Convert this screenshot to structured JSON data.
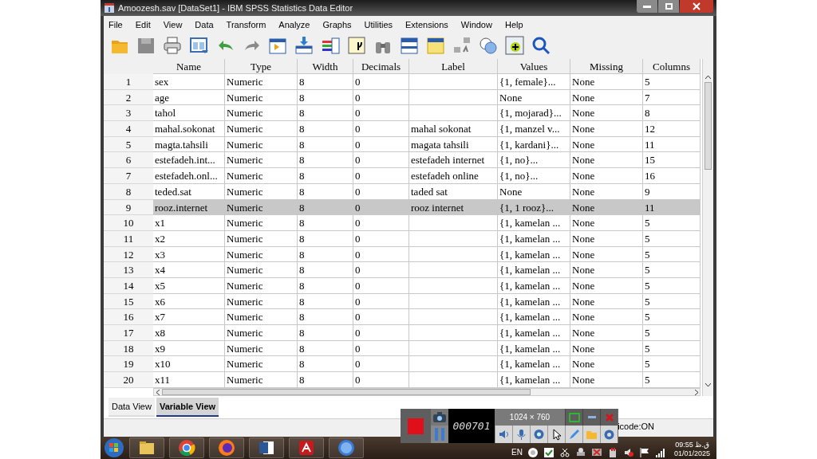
{
  "window": {
    "title": "Amoozesh.sav [DataSet1] - IBM SPSS Statistics Data Editor"
  },
  "menu": [
    "File",
    "Edit",
    "View",
    "Data",
    "Transform",
    "Analyze",
    "Graphs",
    "Utilities",
    "Extensions",
    "Window",
    "Help"
  ],
  "table": {
    "columns": [
      "Name",
      "Type",
      "Width",
      "Decimals",
      "Label",
      "Values",
      "Missing",
      "Columns"
    ],
    "rows": [
      {
        "number": "1",
        "cells": [
          "sex",
          "Numeric",
          "8",
          "0",
          "",
          "{1, female}...",
          "None",
          "5"
        ],
        "selected": false
      },
      {
        "number": "2",
        "cells": [
          "age",
          "Numeric",
          "8",
          "0",
          "",
          "None",
          "None",
          "7"
        ],
        "selected": false
      },
      {
        "number": "3",
        "cells": [
          "tahol",
          "Numeric",
          "8",
          "0",
          "",
          "{1, mojarad}...",
          "None",
          "8"
        ],
        "selected": false
      },
      {
        "number": "4",
        "cells": [
          "mahal.sokonat",
          "Numeric",
          "8",
          "0",
          "mahal sokonat",
          "{1, manzel v...",
          "None",
          "12"
        ],
        "selected": false
      },
      {
        "number": "5",
        "cells": [
          "magta.tahsili",
          "Numeric",
          "8",
          "0",
          "magata tahsili",
          "{1, kardani}...",
          "None",
          "11"
        ],
        "selected": false
      },
      {
        "number": "6",
        "cells": [
          "estefadeh.int...",
          "Numeric",
          "8",
          "0",
          "estefadeh internet",
          "{1, no}...",
          "None",
          "15"
        ],
        "selected": false
      },
      {
        "number": "7",
        "cells": [
          "estefadeh.onl...",
          "Numeric",
          "8",
          "0",
          "estefadeh online",
          "{1, no}...",
          "None",
          "16"
        ],
        "selected": false
      },
      {
        "number": "8",
        "cells": [
          "teded.sat",
          "Numeric",
          "8",
          "0",
          "taded sat",
          "None",
          "None",
          "9"
        ],
        "selected": false
      },
      {
        "number": "9",
        "cells": [
          "rooz.internet",
          "Numeric",
          "8",
          "0",
          "rooz internet",
          "{1, 1 rooz}...",
          "None",
          "11"
        ],
        "selected": true
      },
      {
        "number": "10",
        "cells": [
          "x1",
          "Numeric",
          "8",
          "0",
          "",
          "{1, kamelan ...",
          "None",
          "5"
        ],
        "selected": false
      },
      {
        "number": "11",
        "cells": [
          "x2",
          "Numeric",
          "8",
          "0",
          "",
          "{1, kamelan ...",
          "None",
          "5"
        ],
        "selected": false
      },
      {
        "number": "12",
        "cells": [
          "x3",
          "Numeric",
          "8",
          "0",
          "",
          "{1, kamelan ...",
          "None",
          "5"
        ],
        "selected": false
      },
      {
        "number": "13",
        "cells": [
          "x4",
          "Numeric",
          "8",
          "0",
          "",
          "{1, kamelan ...",
          "None",
          "5"
        ],
        "selected": false
      },
      {
        "number": "14",
        "cells": [
          "x5",
          "Numeric",
          "8",
          "0",
          "",
          "{1, kamelan ...",
          "None",
          "5"
        ],
        "selected": false
      },
      {
        "number": "15",
        "cells": [
          "x6",
          "Numeric",
          "8",
          "0",
          "",
          "{1, kamelan ...",
          "None",
          "5"
        ],
        "selected": false
      },
      {
        "number": "16",
        "cells": [
          "x7",
          "Numeric",
          "8",
          "0",
          "",
          "{1, kamelan ...",
          "None",
          "5"
        ],
        "selected": false
      },
      {
        "number": "17",
        "cells": [
          "x8",
          "Numeric",
          "8",
          "0",
          "",
          "{1, kamelan ...",
          "None",
          "5"
        ],
        "selected": false
      },
      {
        "number": "18",
        "cells": [
          "x9",
          "Numeric",
          "8",
          "0",
          "",
          "{1, kamelan ...",
          "None",
          "5"
        ],
        "selected": false
      },
      {
        "number": "19",
        "cells": [
          "x10",
          "Numeric",
          "8",
          "0",
          "",
          "{1, kamelan ...",
          "None",
          "5"
        ],
        "selected": false
      },
      {
        "number": "20",
        "cells": [
          "x11",
          "Numeric",
          "8",
          "0",
          "",
          "{1, kamelan ...",
          "None",
          "5"
        ],
        "selected": false
      }
    ]
  },
  "tabs": [
    {
      "label": "Data View",
      "selected": false
    },
    {
      "label": "Variable View",
      "selected": true
    }
  ],
  "status_bar": {
    "text": "icode:ON"
  },
  "recorder": {
    "timer": "000701",
    "resolution": "1024 × 760"
  },
  "taskbar": {
    "language": "EN",
    "time": "09:55 ق.ظ",
    "date": "01/01/2025"
  }
}
